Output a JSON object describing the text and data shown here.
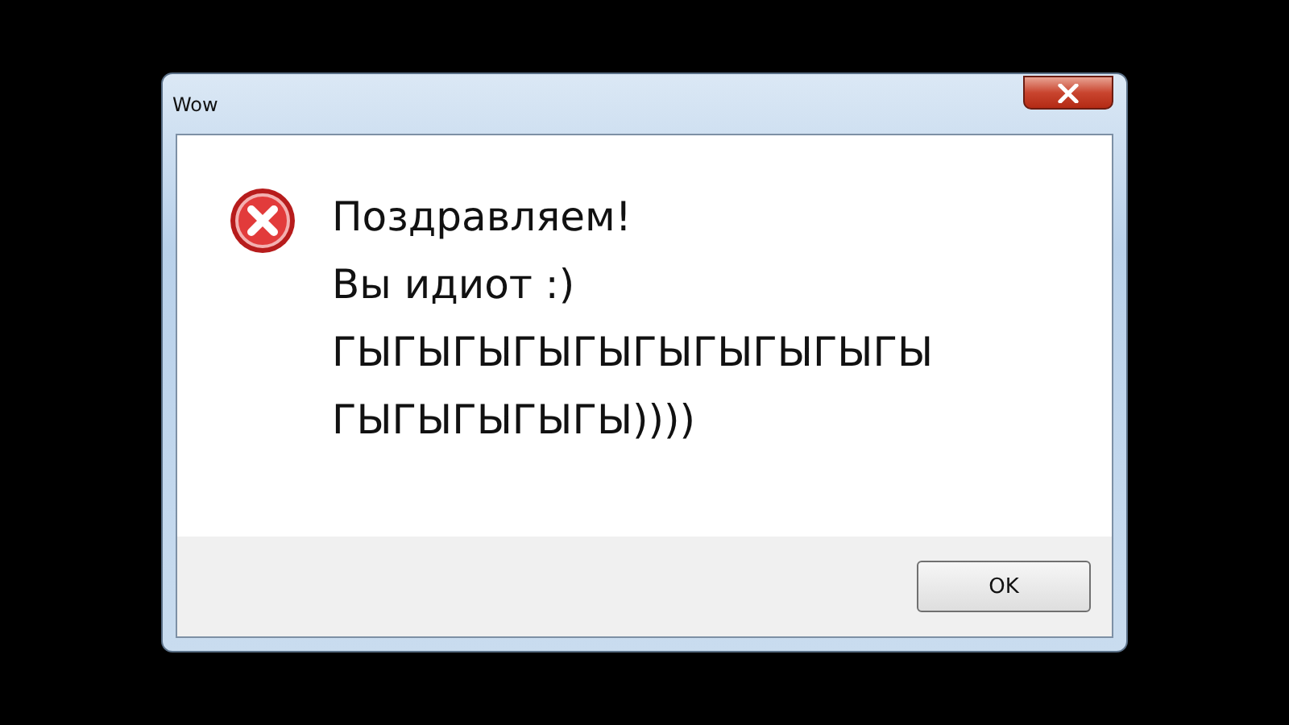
{
  "window": {
    "title": "Wow"
  },
  "message": {
    "kind": "error",
    "lines": [
      "Поздравляем!",
      "Вы идиот :)",
      "ГЫГЫГЫГЫГЫГЫГЫГЫГЫГЫ",
      "ГЫГЫГЫГЫГЫ))))"
    ]
  },
  "buttons": [
    {
      "label": "OK"
    }
  ]
}
